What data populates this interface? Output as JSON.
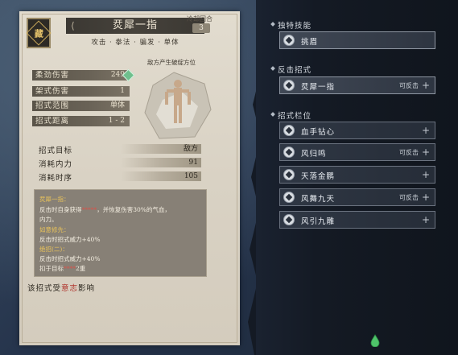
{
  "card": {
    "seal_glyph": "藏",
    "title": "烎犀一指",
    "subtitle": "攻击 · 拳法 · 骗发 · 单体",
    "cooldown_label": "冷却回合",
    "cooldown_value": "3",
    "stats": [
      {
        "label": "柔劲伤害",
        "value": "249"
      },
      {
        "label": "架式伤害",
        "value": "1"
      },
      {
        "label": "招式范围",
        "value": "单体"
      },
      {
        "label": "招式距离",
        "value": "1 - 2"
      }
    ],
    "weak_point_label": "敌方产生破绽方位",
    "info": [
      {
        "label": "招式目标",
        "value": "敌方"
      },
      {
        "label": "消耗内力",
        "value": "91"
      },
      {
        "label": "消耗时序",
        "value": "105"
      }
    ],
    "description": {
      "effect_title": "烎犀一指：",
      "line1_a": "反击时自身获得",
      "line1_red": "*****",
      "line1_b": "，并恢复伤害30%的气血，",
      "line2": "内力。",
      "bonus_title": "如意修先：",
      "line3": "反击时招式威力+40%",
      "line4_title": "绝招(二)：",
      "line4": "反击时招式威力+40%",
      "line5_a": "扣于目标",
      "line5_red": "****",
      "line5_b": "2重"
    },
    "footer_a": "该招式受",
    "footer_red": "意志",
    "footer_b": "影响"
  },
  "right": {
    "unique_title": "独特技能",
    "unique_skill": "挑眉",
    "counter_title": "反击招式",
    "counter_skill": {
      "name": "烎犀一指",
      "tag": "可反击"
    },
    "slots_title": "招式栏位",
    "slots": [
      {
        "name": "血手钻心",
        "tag": ""
      },
      {
        "name": "风归鸣",
        "tag": "可反击"
      },
      {
        "name": "天落金鹏",
        "tag": ""
      },
      {
        "name": "风舞九天",
        "tag": "可反击"
      },
      {
        "name": "风引九雕",
        "tag": ""
      }
    ]
  }
}
